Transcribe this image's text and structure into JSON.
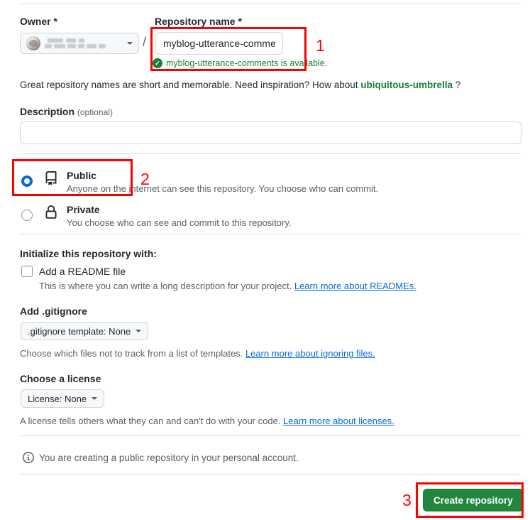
{
  "form": {
    "owner": {
      "label": "Owner *",
      "avatar_icon": "user-avatar",
      "name_redacted": true,
      "caret_icon": "chevron-down-icon",
      "separator": "/"
    },
    "repo_name": {
      "label": "Repository name *",
      "value": "myblog-utterance-comments",
      "placeholder": "",
      "availability_text": "myblog-utterance-comments is available.",
      "availability_icon": "check-circle-icon",
      "availability_color": "#1a7f37"
    },
    "hint": {
      "text_before": "Great repository names are short and memorable. Need inspiration? How about",
      "suggestion": "ubiquitous-umbrella",
      "text_after": "?"
    },
    "description": {
      "label": "Description",
      "optional_label": "(optional)",
      "value": "",
      "placeholder": ""
    },
    "visibility": {
      "options": [
        {
          "id": "public",
          "title": "Public",
          "description": "Anyone on the internet can see this repository. You choose who can commit.",
          "icon": "repo-book-icon",
          "selected": true
        },
        {
          "id": "private",
          "title": "Private",
          "description": "You choose who can see and commit to this repository.",
          "icon": "lock-icon",
          "selected": false
        }
      ]
    },
    "initialize": {
      "heading": "Initialize this repository with:",
      "readme": {
        "label": "Add a README file",
        "checked": false,
        "description_before": "This is where you can write a long description for your project.",
        "link_text": "Learn more about READMEs."
      }
    },
    "gitignore": {
      "heading": "Add .gitignore",
      "selected_value": ".gitignore template: None",
      "caret_icon": "chevron-down-icon",
      "description_before": "Choose which files not to track from a list of templates.",
      "link_text": "Learn more about ignoring files."
    },
    "license": {
      "heading": "Choose a license",
      "selected_value": "License: None",
      "caret_icon": "chevron-down-icon",
      "description_before": "A license tells others what they can and can't do with your code.",
      "link_text": "Learn more about licenses."
    },
    "info_note": {
      "icon": "info-icon",
      "text": "You are creating a public repository in your personal account."
    },
    "submit": {
      "label": "Create repository",
      "color": "#1f883d"
    }
  },
  "annotations": {
    "color": "#ff0000",
    "markers": [
      {
        "id": "1",
        "label": "1",
        "targets": "repository-name-field"
      },
      {
        "id": "2",
        "label": "2",
        "targets": "public-visibility-option"
      },
      {
        "id": "3",
        "label": "3",
        "targets": "create-repository-button"
      }
    ]
  }
}
